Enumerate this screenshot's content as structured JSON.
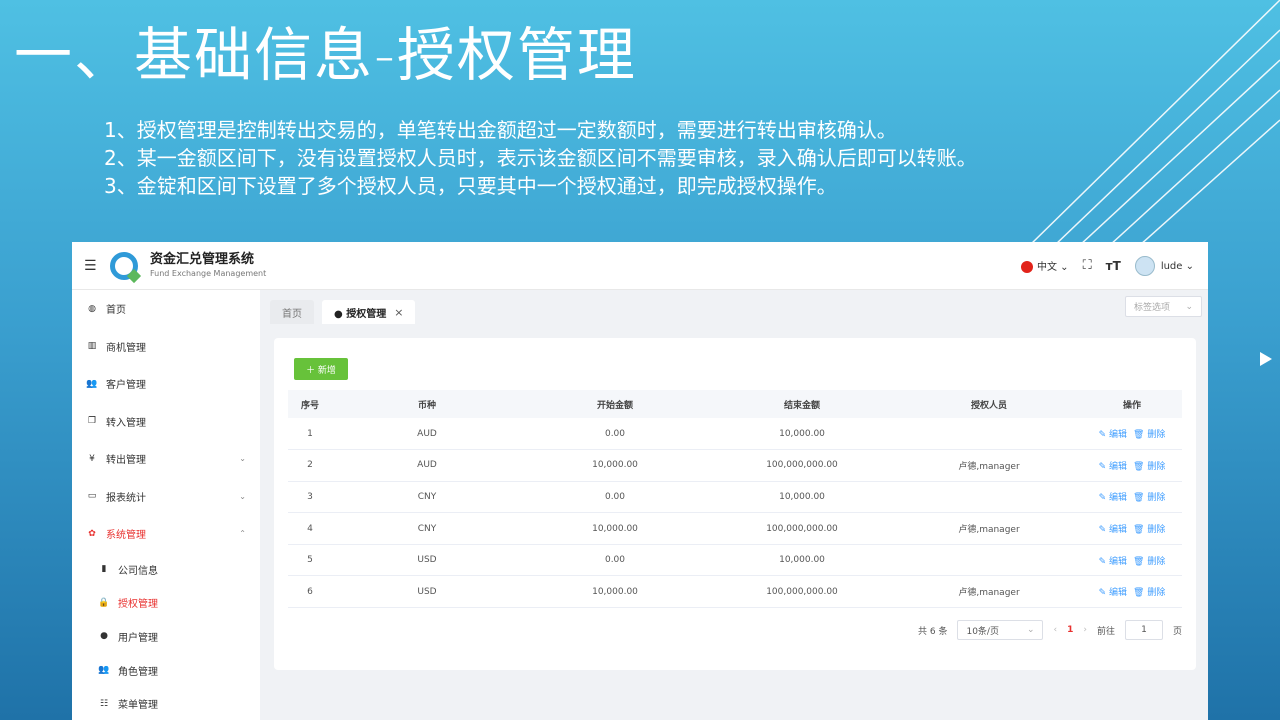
{
  "slide": {
    "title": "一、基础信息-授权管理",
    "notes": [
      "1、授权管理是控制转出交易的，单笔转出金额超过一定数额时，需要进行转出审核确认。",
      "2、某一金额区间下，没有设置授权人员时，表示该金额区间不需要审核，录入确认后即可以转账。",
      "3、金锭和区间下设置了多个授权人员，只要其中一个授权通过，即完成授权操作。"
    ]
  },
  "app": {
    "brand_title": "资金汇兑管理系统",
    "brand_sub": "Fund Exchange Management",
    "lang": "中文",
    "user": "lude",
    "sidebar": [
      {
        "label": "首页",
        "icon": "dashboard-icon"
      },
      {
        "label": "商机管理",
        "icon": "columns-icon"
      },
      {
        "label": "客户管理",
        "icon": "users-icon"
      },
      {
        "label": "转入管理",
        "icon": "copy-icon"
      },
      {
        "label": "转出管理",
        "icon": "yen-icon"
      },
      {
        "label": "报表统计",
        "icon": "monitor-icon"
      },
      {
        "label": "系统管理",
        "icon": "gear-icon"
      }
    ],
    "sub_menu": [
      {
        "label": "公司信息",
        "icon": "building-icon"
      },
      {
        "label": "授权管理",
        "icon": "lock-icon"
      },
      {
        "label": "用户管理",
        "icon": "user-icon"
      },
      {
        "label": "角色管理",
        "icon": "users-icon"
      },
      {
        "label": "菜单管理",
        "icon": "list-icon"
      }
    ],
    "tabs": {
      "home": "首页",
      "current": "● 授权管理",
      "options": "标签选项"
    },
    "add_button": "＋ 新增",
    "columns": [
      "序号",
      "币种",
      "开始金额",
      "结束金额",
      "授权人员",
      "操作"
    ],
    "rows": [
      [
        "1",
        "AUD",
        "0.00",
        "10,000.00",
        ""
      ],
      [
        "2",
        "AUD",
        "10,000.00",
        "100,000,000.00",
        "卢德,manager"
      ],
      [
        "3",
        "CNY",
        "0.00",
        "10,000.00",
        ""
      ],
      [
        "4",
        "CNY",
        "10,000.00",
        "100,000,000.00",
        "卢德,manager"
      ],
      [
        "5",
        "USD",
        "0.00",
        "10,000.00",
        ""
      ],
      [
        "6",
        "USD",
        "10,000.00",
        "100,000,000.00",
        "卢德,manager"
      ]
    ],
    "edit_label": "编辑",
    "delete_label": "删除",
    "pager": {
      "total": "共 6 条",
      "size": "10条/页",
      "page": "1",
      "goto": "前往",
      "input": "1",
      "unit": "页"
    }
  }
}
